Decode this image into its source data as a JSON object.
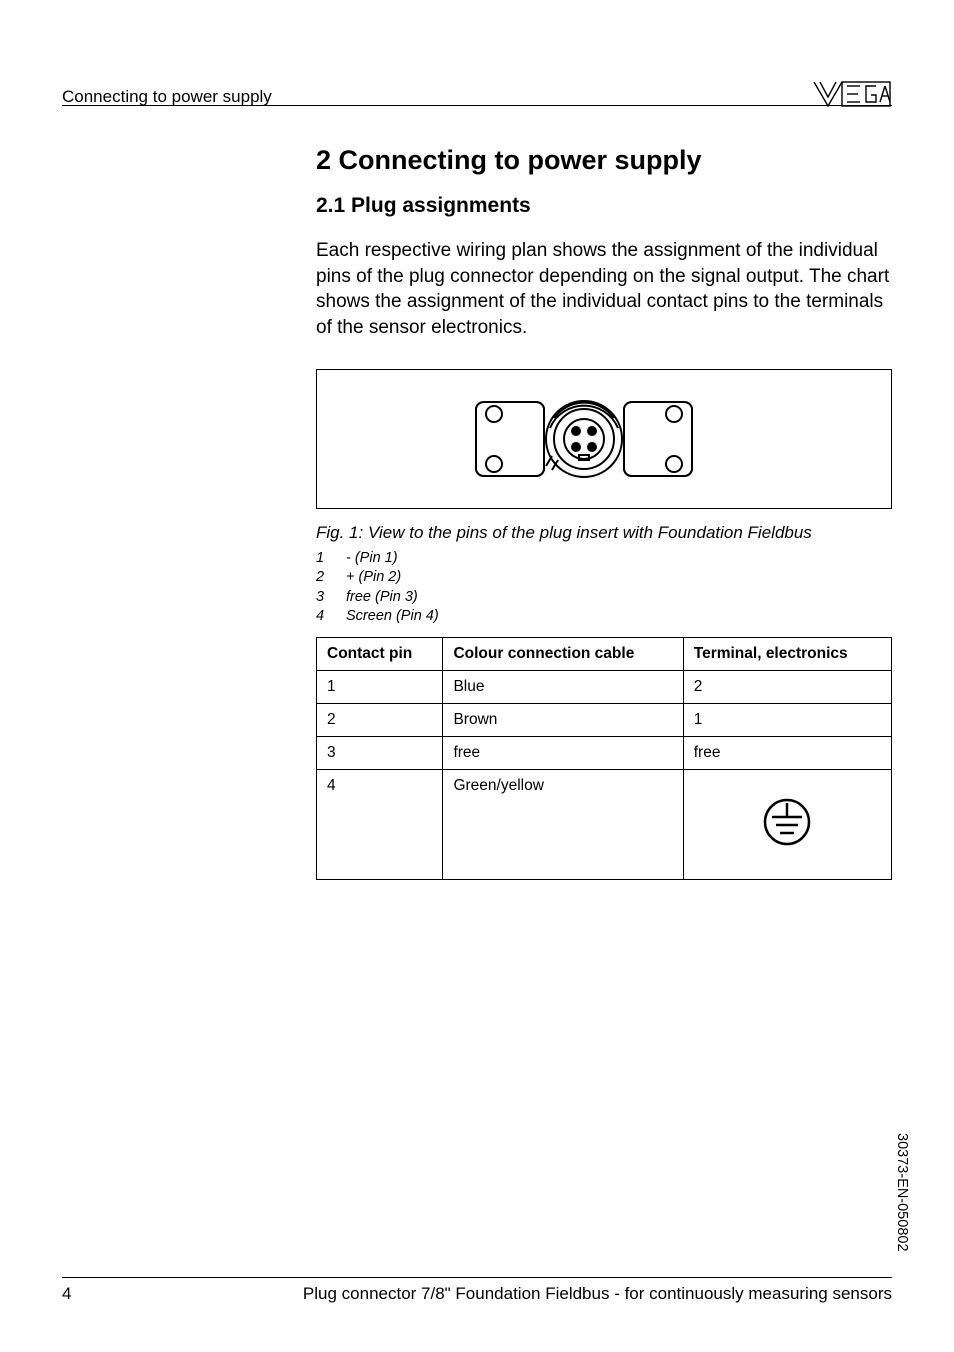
{
  "header": {
    "section": "Connecting to power supply"
  },
  "content": {
    "chapter_title": "2  Connecting to power supply",
    "section_title": "2.1  Plug assignments",
    "body": "Each respective wiring plan shows the assignment of the individual pins of the plug connector depending on the signal output. The chart shows the assignment of the individual contact pins to the terminals of the sensor electronics.",
    "figure_caption": "Fig. 1: View to the pins of the plug insert with Foundation Fieldbus",
    "legend": [
      {
        "n": "1",
        "t": "- (Pin 1)"
      },
      {
        "n": "2",
        "t": "+ (Pin 2)"
      },
      {
        "n": "3",
        "t": "free (Pin 3)"
      },
      {
        "n": "4",
        "t": "Screen (Pin 4)"
      }
    ],
    "table": {
      "headers": [
        "Contact pin",
        "Colour connection cable",
        "Terminal, electronics"
      ],
      "rows": [
        {
          "pin": "1",
          "colour": "Blue",
          "terminal": "2"
        },
        {
          "pin": "2",
          "colour": "Brown",
          "terminal": "1"
        },
        {
          "pin": "3",
          "colour": "free",
          "terminal": "free"
        },
        {
          "pin": "4",
          "colour": "Green/yellow",
          "terminal": "__GROUND__"
        }
      ]
    }
  },
  "chart_data": {
    "type": "table",
    "title": "Plug assignments — Foundation Fieldbus",
    "columns": [
      "Contact pin",
      "Colour connection cable",
      "Terminal, electronics"
    ],
    "rows": [
      [
        "1",
        "Blue",
        "2"
      ],
      [
        "2",
        "Brown",
        "1"
      ],
      [
        "3",
        "free",
        "free"
      ],
      [
        "4",
        "Green/yellow",
        "Ground"
      ]
    ]
  },
  "footer": {
    "page": "4",
    "title": "Plug connector 7/8\" Foundation Fieldbus - for continuously measuring sensors"
  },
  "doc_id": "30373-EN-050802"
}
